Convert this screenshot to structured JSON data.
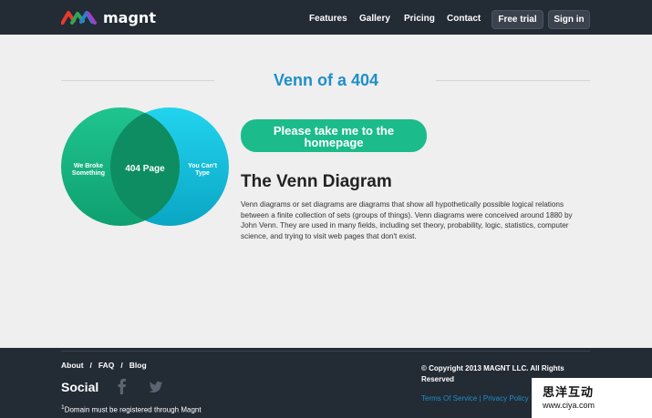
{
  "header": {
    "brand": "magnt",
    "nav": [
      "Features",
      "Gallery",
      "Pricing",
      "Contact"
    ],
    "free_trial": "Free trial",
    "sign_in": "Sign in"
  },
  "main": {
    "title": "Venn of a 404",
    "venn": {
      "left_label_1": "We Broke",
      "left_label_2": "Something",
      "center_label": "404 Page",
      "right_label_1": "You Can't",
      "right_label_2": "Type"
    },
    "cta_line1": "Please take me to the",
    "cta_line2": "homepage",
    "heading": "The Venn Diagram",
    "description": "Venn diagrams or set diagrams are diagrams that show all hypothetically possible logical relations between a finite collection of sets (groups of things). Venn diagrams were conceived around 1880 by John Venn. They are used in many fields, including set theory, probability, logic, statistics, computer science, and trying to visit web pages that don't exist."
  },
  "footer": {
    "links": [
      "About",
      "FAQ",
      "Blog"
    ],
    "separator": "/",
    "social_title": "Social",
    "note_sup": "1",
    "note": "Domain must be registered through Magnt",
    "copyright": "© Copyright 2013 MAGNT LLC. All Rights Reserved",
    "terms": "Terms Of Service",
    "terms_sep": "|",
    "privacy": "Privacy Policy"
  },
  "watermark": {
    "line1": "思洋互动",
    "line2": "www.ciya.com"
  },
  "colors": {
    "topbar": "#232b35",
    "accent_blue": "#1f8fc9",
    "cta_green": "#1cbb8b",
    "venn_green": "#17b783",
    "venn_cyan": "#19c3dc"
  }
}
